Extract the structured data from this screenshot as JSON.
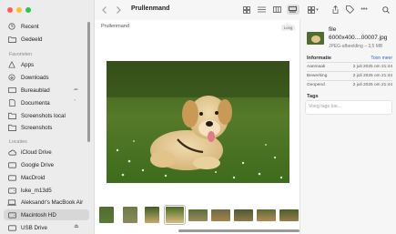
{
  "sidebar": {
    "favorites": [
      {
        "label": "Recent",
        "icon": "clock-icon"
      },
      {
        "label": "Gedeeld",
        "icon": "shared-folder-icon"
      }
    ],
    "favorites_header": "Favorieten",
    "favorites_items": [
      {
        "label": "Apps",
        "icon": "apps-icon"
      },
      {
        "label": "Downloads",
        "icon": "download-icon"
      },
      {
        "label": "Bureaublad",
        "icon": "desktop-icon"
      },
      {
        "label": "Documenta",
        "icon": "document-icon"
      },
      {
        "label": "Screenshots local",
        "icon": "folder-icon"
      },
      {
        "label": "Screenshots",
        "icon": "folder-icon"
      }
    ],
    "locations_header": "Locaties",
    "locations": [
      {
        "label": "iCloud Drive",
        "icon": "cloud-icon"
      },
      {
        "label": "Google Drive",
        "icon": "drive-icon"
      },
      {
        "label": "MacDroid",
        "icon": "drive-icon"
      },
      {
        "label": "luke_m13d5",
        "icon": "disk-icon"
      },
      {
        "label": "Aleksandr's MacBook Air",
        "icon": "laptop-icon"
      },
      {
        "label": "Macintosh HD",
        "icon": "disk-icon"
      },
      {
        "label": "USB Drive",
        "icon": "usb-disk-icon"
      }
    ]
  },
  "toolbar": {
    "title": "Prullenmand",
    "back_icon": "chevron-left-icon",
    "forward_icon": "chevron-right-icon"
  },
  "content": {
    "folder_label": "Prullenmand",
    "tag_label": "Leeg"
  },
  "inspector": {
    "file_name_line1": "file",
    "file_name_line2": "6000x400....00007.jpg",
    "file_subtitle": "JPEG-afbeelding – 3,5 MB",
    "info_header": "Informatie",
    "show_more": "Toon meer",
    "rows": [
      {
        "label": "Aanmaak",
        "value": "2 juli 2025 om 21:44"
      },
      {
        "label": "Bewerking",
        "value": "2 juli 2025 om 21:44"
      },
      {
        "label": "Geopend",
        "value": "2 juli 2025 om 21:44"
      }
    ],
    "tags_header": "Tags",
    "tags_placeholder": "Voeg tags toe..."
  },
  "colors": {
    "accent": "#2a6bd0",
    "sidebar_bg": "#ececec",
    "selection_bg": "#d7d7d7"
  }
}
